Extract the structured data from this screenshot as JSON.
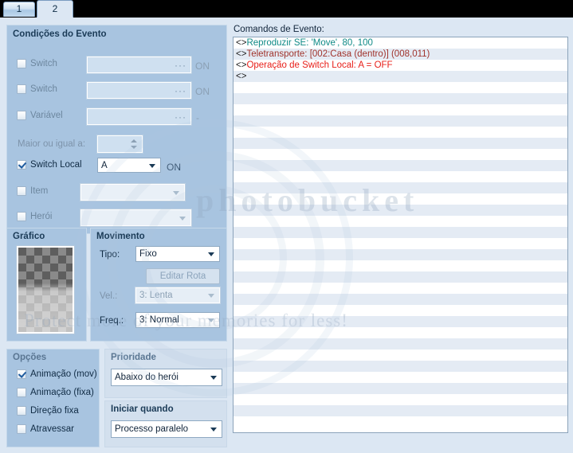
{
  "tabs": [
    {
      "label": "1",
      "active": false
    },
    {
      "label": "2",
      "active": true
    }
  ],
  "conditions": {
    "title": "Condições do Evento",
    "rows": [
      {
        "label": "Switch",
        "checked": false,
        "value": "",
        "suffix": "ON",
        "dots": "···"
      },
      {
        "label": "Switch",
        "checked": false,
        "value": "",
        "suffix": "ON",
        "dots": "···"
      },
      {
        "label": "Variável",
        "checked": false,
        "value": "",
        "suffix": "-",
        "dots": "···"
      }
    ],
    "variable_compare_label": "Maior ou igual a:",
    "variable_compare_value": "",
    "local_switch": {
      "label": "Switch Local",
      "checked": true,
      "value": "A",
      "suffix": "ON"
    },
    "item": {
      "label": "Item",
      "checked": false,
      "value": ""
    },
    "hero": {
      "label": "Herói",
      "checked": false,
      "value": ""
    }
  },
  "graphic": {
    "title": "Gráfico"
  },
  "movement": {
    "title": "Movimento",
    "type_label": "Tipo:",
    "type_value": "Fixo",
    "edit_route_button": "Editar Rota",
    "speed_label": "Vel.:",
    "speed_value": "3: Lenta",
    "freq_label": "Freq.:",
    "freq_value": "3: Normal"
  },
  "options": {
    "title": "Opções",
    "items": [
      {
        "label": "Animação (mov)",
        "checked": true
      },
      {
        "label": "Animação (fixa)",
        "checked": false
      },
      {
        "label": "Direção fixa",
        "checked": false
      },
      {
        "label": "Atravessar",
        "checked": false
      }
    ]
  },
  "priority": {
    "title": "Prioridade",
    "value": "Abaixo do herói"
  },
  "trigger": {
    "title": "Iniciar quando",
    "value": "Processo paralelo"
  },
  "commands": {
    "label": "Comandos de Evento:",
    "marker": "<>",
    "rows": [
      {
        "text": "Reproduzir SE: 'Move', 80, 100",
        "color": "#0f8a86"
      },
      {
        "text": "Teletransporte: [002:Casa (dentro)] (008,011)",
        "color": "#a0332c"
      },
      {
        "text": "Operação de Switch Local: A = OFF",
        "color": "#e8201a"
      },
      {
        "text": "",
        "color": "#222222"
      }
    ],
    "empty_rows": 31
  },
  "watermark": {
    "brand": "photobucket",
    "tagline": "Protect more of your memories for less!",
    "glyph": "p"
  }
}
